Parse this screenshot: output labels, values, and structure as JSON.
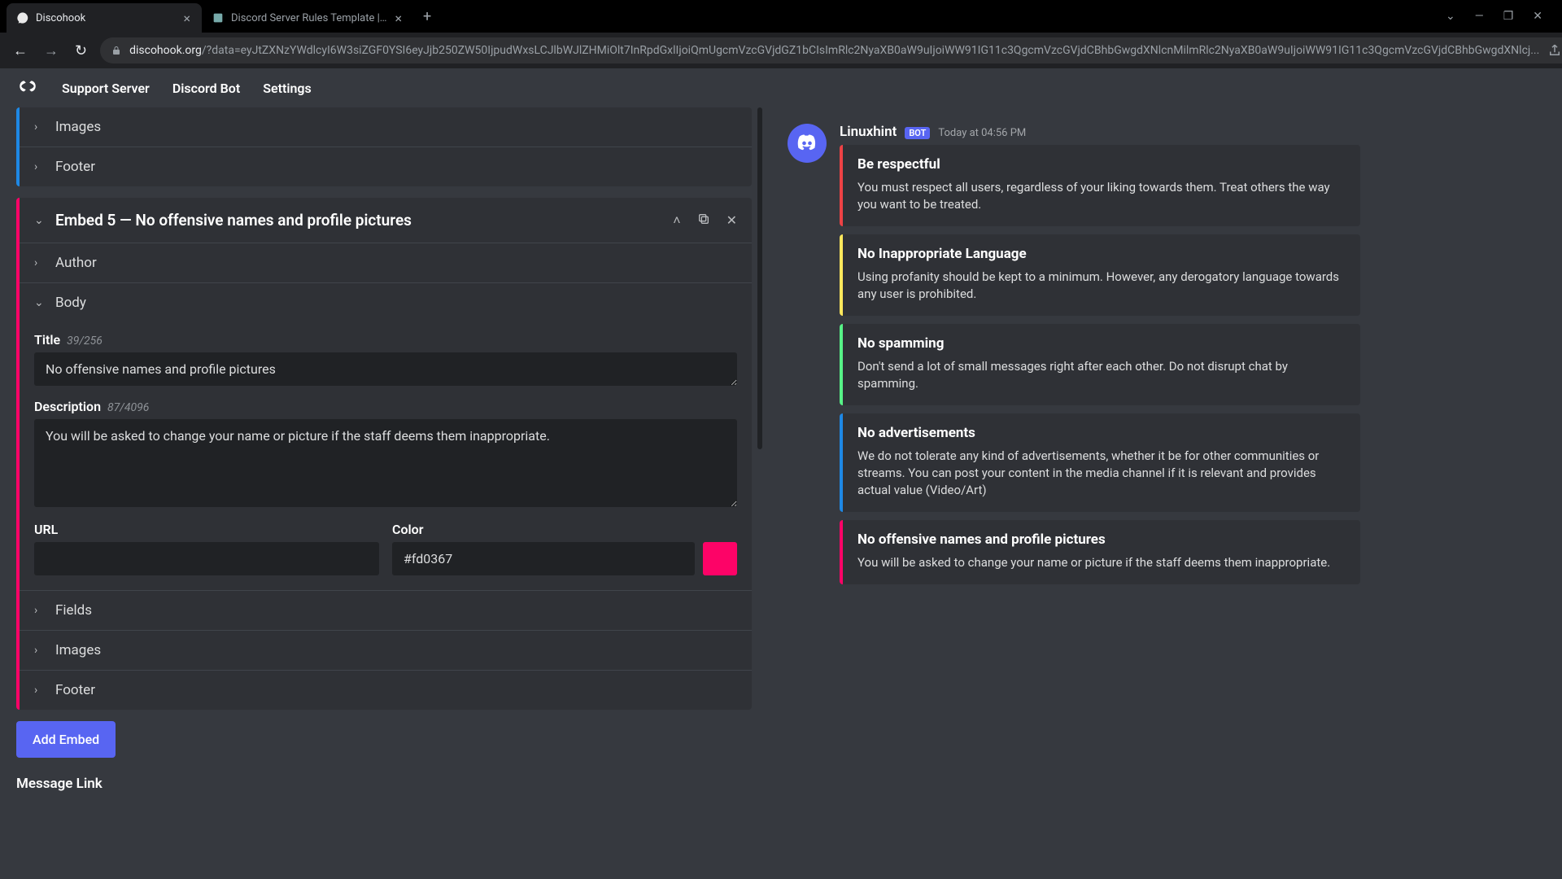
{
  "browser": {
    "tabs": [
      {
        "title": "Discohook",
        "active": true
      },
      {
        "title": "Discord Server Rules Template | D",
        "active": false
      }
    ],
    "url_host": "discohook.org",
    "url_path": "/?data=eyJtZXNzYWdlcyI6W3siZGF0YSI6eyJjb250ZW50IjpudWxsLCJlbWJlZHMiOlt7InRpdGxlIjoiQmUgcmVzcGVjdGZ1bCIsImRlc2NyaXB0aW9uIjoiWW91IG11c3QgcmVzcGVjdCBhbGwgdXNlcnMilmRlc2NyaXB0aW9uIjoiWW91IG11c3QgcmVzcGVjdCBhbGwgdXNlcj...",
    "profile_initial": "N"
  },
  "nav": {
    "support": "Support Server",
    "bot": "Discord Bot",
    "settings": "Settings"
  },
  "editor": {
    "prev_sections": {
      "images": "Images",
      "footer": "Footer"
    },
    "embed5": {
      "header": "Embed 5 — No offensive names and profile pictures",
      "author": "Author",
      "body": "Body",
      "title_label": "Title",
      "title_counter": "39/256",
      "title_value": "No offensive names and profile pictures",
      "desc_label": "Description",
      "desc_counter": "87/4096",
      "desc_value": "You will be asked to change your name or picture if the staff deems them inappropriate.",
      "url_label": "URL",
      "url_value": "",
      "color_label": "Color",
      "color_value": "#fd0367",
      "fields": "Fields",
      "images": "Images",
      "footer": "Footer"
    },
    "add_embed": "Add Embed",
    "message_link": "Message Link"
  },
  "preview": {
    "author": "Linuxhint",
    "bot": "BOT",
    "time": "Today at 04:56 PM",
    "embeds": [
      {
        "color": "red",
        "title": "Be respectful",
        "desc": "You must respect all users, regardless of your liking towards them. Treat others the way you want to be treated."
      },
      {
        "color": "yellow",
        "title": "No Inappropriate Language",
        "desc": "Using profanity should be kept to a minimum. However, any derogatory language towards any user is prohibited."
      },
      {
        "color": "green",
        "title": "No spamming",
        "desc": "Don't send a lot of small messages right after each other. Do not disrupt chat by spamming."
      },
      {
        "color": "pblue",
        "title": "No advertisements",
        "desc": "We do not tolerate any kind of advertisements, whether it be for other communities or streams. You can post your content in the media channel if it is relevant and provides actual value (Video/Art)"
      },
      {
        "color": "ppink",
        "title": "No offensive names and profile pictures",
        "desc": "You will be asked to change your name or picture if the staff deems them inappropriate."
      }
    ]
  }
}
